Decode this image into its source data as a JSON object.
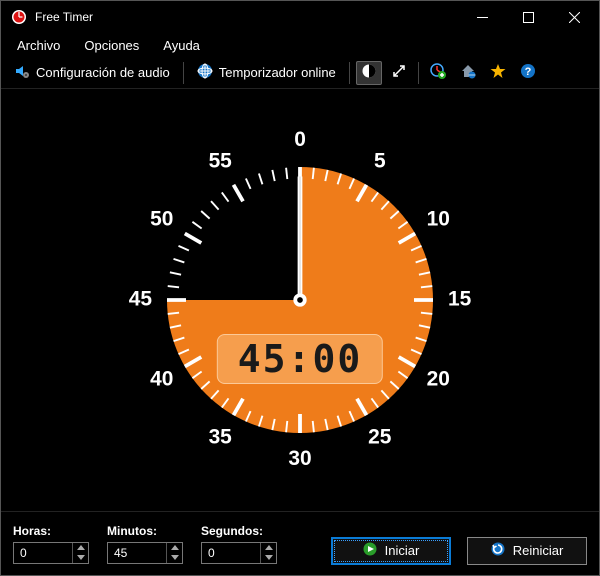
{
  "window": {
    "title": "Free Timer"
  },
  "menu": {
    "archivo": "Archivo",
    "opciones": "Opciones",
    "ayuda": "Ayuda"
  },
  "toolbar": {
    "audio_config": "Configuración de audio",
    "online_timer": "Temporizador online"
  },
  "clock": {
    "digital": "45:00",
    "minutes_set": 45,
    "labels": {
      "n0": "0",
      "n5": "5",
      "n10": "10",
      "n15": "15",
      "n20": "20",
      "n25": "25",
      "n30": "30",
      "n35": "35",
      "n40": "40",
      "n45": "45",
      "n50": "50",
      "n55": "55"
    }
  },
  "inputs": {
    "hours_label": "Horas:",
    "hours_value": "0",
    "minutes_label": "Minutos:",
    "minutes_value": "45",
    "seconds_label": "Segundos:",
    "seconds_value": "0"
  },
  "buttons": {
    "start": "Iniciar",
    "reset": "Reiniciar"
  },
  "colors": {
    "accent": "#ef7c1a",
    "accent_light": "#f8a555"
  }
}
